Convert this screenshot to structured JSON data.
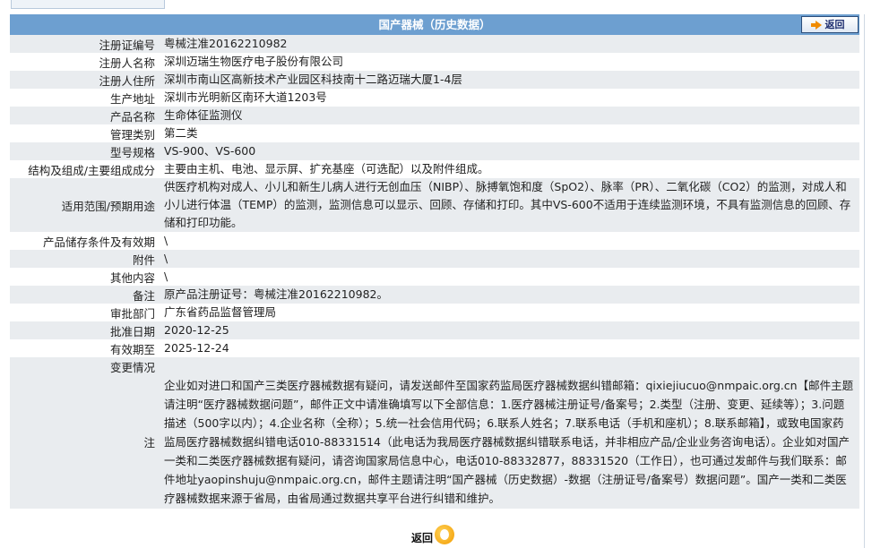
{
  "header": {
    "title": "国产器械（历史数据）",
    "back_label": "返回"
  },
  "rows": [
    {
      "label": "注册证编号",
      "value": "粤械注准20162210982"
    },
    {
      "label": "注册人名称",
      "value": "深圳迈瑞生物医疗电子股份有限公司"
    },
    {
      "label": "注册人住所",
      "value": "深圳市南山区高新技术产业园区科技南十二路迈瑞大厦1-4层"
    },
    {
      "label": "生产地址",
      "value": "深圳市光明新区南环大道1203号"
    },
    {
      "label": "产品名称",
      "value": "生命体征监测仪"
    },
    {
      "label": "管理类别",
      "value": "第二类"
    },
    {
      "label": "型号规格",
      "value": "VS-900、VS-600"
    },
    {
      "label": "结构及组成/主要组成成分",
      "value": "主要由主机、电池、显示屏、扩充基座（可选配）以及附件组成。"
    },
    {
      "label": "适用范围/预期用途",
      "value": "供医疗机构对成人、小儿和新生儿病人进行无创血压（NIBP）、脉搏氧饱和度（SpO2）、脉率（PR）、二氧化碳（CO2）的监测，对成人和小儿进行体温（TEMP）的监测，监测信息可以显示、回顾、存储和打印。其中VS-600不适用于连续监测环境，不具有监测信息的回顾、存储和打印功能。"
    },
    {
      "label": "产品储存条件及有效期",
      "value": "\\"
    },
    {
      "label": "附件",
      "value": "\\"
    },
    {
      "label": "其他内容",
      "value": "\\"
    },
    {
      "label": "备注",
      "value": "原产品注册证号：粤械注准20162210982。"
    },
    {
      "label": "审批部门",
      "value": "广东省药品监督管理局"
    },
    {
      "label": "批准日期",
      "value": "2020-12-25"
    },
    {
      "label": "有效期至",
      "value": "2025-12-24"
    },
    {
      "label": "变更情况",
      "value": ""
    }
  ],
  "note": {
    "label": "注",
    "text": "企业如对进口和国产三类医疗器械数据有疑问，请发送邮件至国家药监局医疗器械数据纠错邮箱：qixiejiucuo@nmpaic.org.cn【邮件主题请注明“医疗器械数据问题”，邮件正文中请准确填写以下全部信息：1.医疗器械注册证号/备案号；2.类型（注册、变更、延续等）；3.问题描述（500字以内）；4.企业名称（全称）；5.统一社会信用代码；6.联系人姓名；7.联系电话（手机和座机）；8.联系邮箱】，或致电国家药监局医疗器械数据纠错电话010-88331514（此电话为我局医疗器械数据纠错联系电话，并非相应产品/企业业务咨询电话）。企业如对国产一类和二类医疗器械数据有疑问，请咨询国家局信息中心，电话010-88332877，88331520（工作日），也可通过发邮件与我们联系：邮件地址yaopinshuju@nmpaic.org.cn，邮件主题请注明“国产器械（历史数据）-数据（注册证号/备案号）数据问题”。国产一类和二类医疗器械数据来源于省局，由省局通过数据共享平台进行纠错和维护。"
  },
  "footer": {
    "back_label": "返回"
  },
  "colors": {
    "header_bg": "#6d9fd0",
    "row_alt_bg": "#e9ecef",
    "accent_orange": "#f08c00"
  }
}
